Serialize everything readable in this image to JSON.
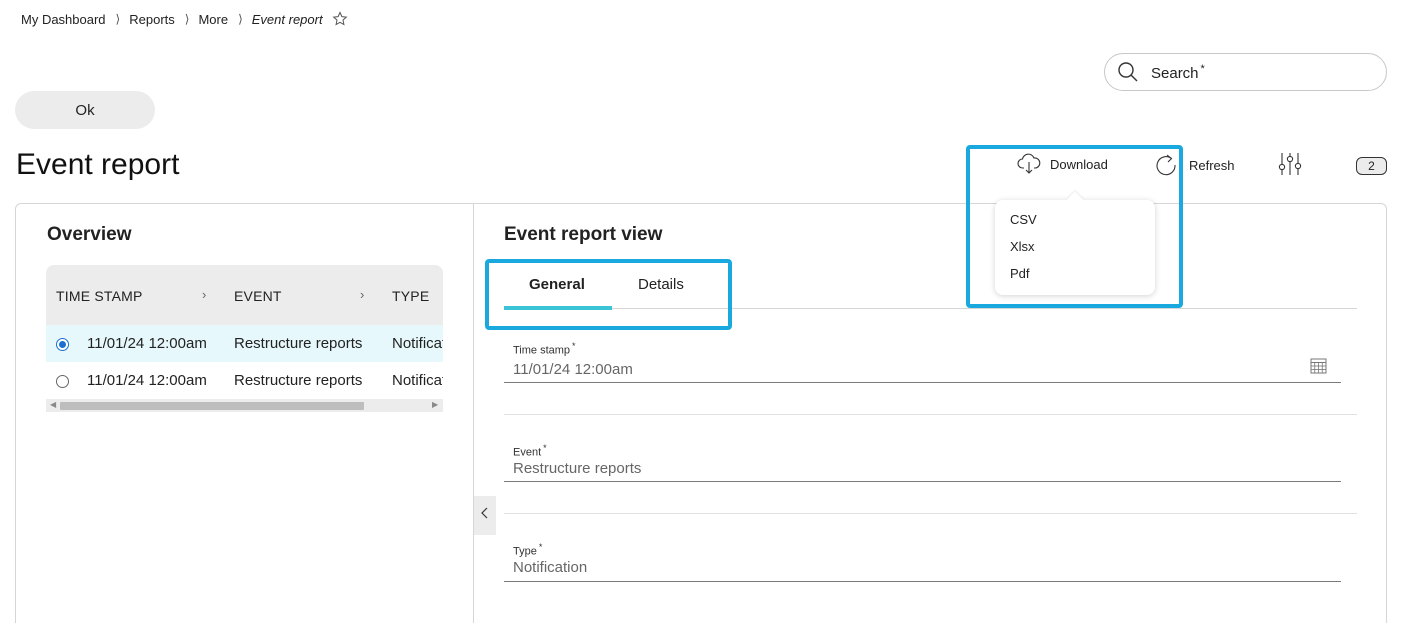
{
  "breadcrumb": {
    "items": [
      "My Dashboard",
      "Reports",
      "More"
    ],
    "current": "Event report",
    "separator": "⟩"
  },
  "search": {
    "placeholder": "Search",
    "required_mark": "*"
  },
  "ok_button": {
    "label": "Ok"
  },
  "page": {
    "title": "Event report"
  },
  "toolbar": {
    "download_label": "Download",
    "refresh_label": "Refresh",
    "badge_count": "2"
  },
  "download_menu": {
    "options": [
      "CSV",
      "Xlsx",
      "Pdf"
    ]
  },
  "overview": {
    "title": "Overview",
    "columns": [
      "TIME STAMP",
      "EVENT",
      "TYPE"
    ],
    "sort_glyph": "›",
    "rows": [
      {
        "time": "11/01/24 12:00am",
        "event": "Restructure reports",
        "type": "Notification",
        "selected": true
      },
      {
        "time": "11/01/24 12:00am",
        "event": "Restructure reports",
        "type": "Notification",
        "selected": false
      }
    ]
  },
  "view": {
    "title": "Event report view",
    "tabs": [
      "General",
      "Details"
    ],
    "active_tab": "General",
    "fields": [
      {
        "label": "Time stamp",
        "value": "11/01/24 12:00am"
      },
      {
        "label": "Event",
        "value": "Restructure reports"
      },
      {
        "label": "Type",
        "value": "Notification"
      }
    ],
    "required_mark": "*"
  },
  "colors": {
    "accent": "#1aa9de",
    "tab_underline": "#3bc3d8",
    "selected_row": "#e6f8fb",
    "radio": "#1a6fd0"
  }
}
